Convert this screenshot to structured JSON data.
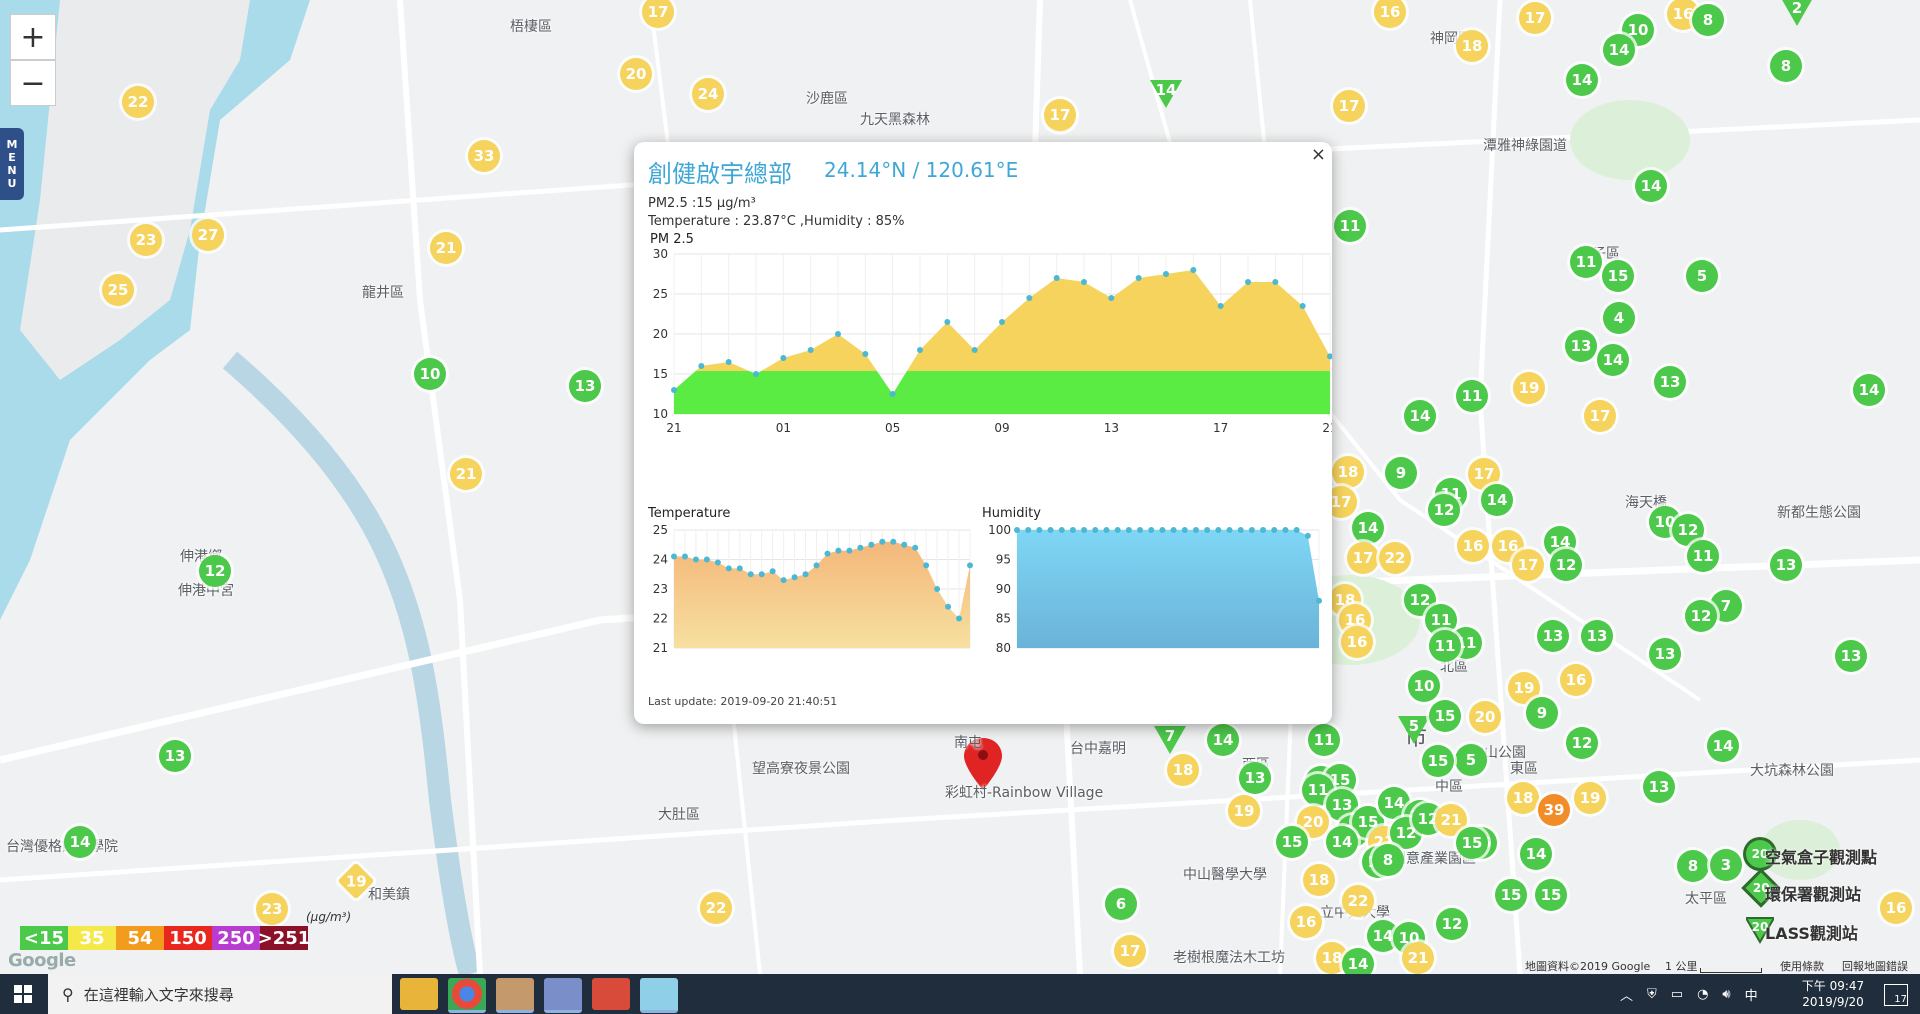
{
  "map": {
    "zoom_in": "+",
    "zoom_out": "−",
    "menu_letters": [
      "M",
      "E",
      "N",
      "U"
    ],
    "places": [
      {
        "id": "wuqi",
        "name": "梧棲區"
      },
      {
        "id": "shalu",
        "name": "沙鹿區"
      },
      {
        "id": "jiutianheisenlin",
        "name": "九天黑森林"
      },
      {
        "id": "longjing",
        "name": "龍井區"
      },
      {
        "id": "shengang",
        "name": "神岡區"
      },
      {
        "id": "tanya",
        "name": "潭雅神綠園道"
      },
      {
        "id": "tanzi",
        "name": "潭子區"
      },
      {
        "id": "xinshe",
        "name": "新都生態公園"
      },
      {
        "id": "haitiangiao",
        "name": "海天橋"
      },
      {
        "id": "shengang2",
        "name": "伸港鄉"
      },
      {
        "id": "shengang3",
        "name": "伸港中宮"
      },
      {
        "id": "wanggao",
        "name": "望高寮夜景公園"
      },
      {
        "id": "dadu",
        "name": "大肚區"
      },
      {
        "id": "caihong",
        "name": "彩虹村-Rainbow Village"
      },
      {
        "id": "nan",
        "name": "南屯"
      },
      {
        "id": "taichung_park",
        "name": "台中嘉明"
      },
      {
        "id": "xi",
        "name": "西區"
      },
      {
        "id": "bei",
        "name": "北區"
      },
      {
        "id": "city",
        "name": "市"
      },
      {
        "id": "zhong",
        "name": "中區"
      },
      {
        "id": "dong",
        "name": "東區"
      },
      {
        "id": "zhongshan",
        "name": "中山醫學大學"
      },
      {
        "id": "taiping",
        "name": "太平區"
      },
      {
        "id": "ldong",
        "name": "老樹根魔法木工坊"
      },
      {
        "id": "taiwan_stone",
        "name": "台灣優格餅乾學院"
      },
      {
        "id": "he_mei",
        "name": "和美鎮"
      },
      {
        "id": "daya",
        "name": "大坑森林公園"
      },
      {
        "id": "center",
        "name": "文化創意產業園區"
      },
      {
        "id": "zhongxing",
        "name": "立中興大學"
      },
      {
        "id": "fengyuan",
        "name": "豐原"
      },
      {
        "id": "park2",
        "name": "中山公園"
      }
    ],
    "markers": [
      {
        "v": "17",
        "c": "y"
      },
      {
        "v": "16",
        "c": "y"
      },
      {
        "v": "18",
        "c": "y"
      },
      {
        "v": "17",
        "c": "y"
      },
      {
        "v": "10",
        "c": "g"
      },
      {
        "v": "16",
        "c": "y"
      },
      {
        "v": "8",
        "c": "g"
      },
      {
        "v": "2",
        "c": "g",
        "t": "tri"
      },
      {
        "v": "22",
        "c": "y"
      },
      {
        "v": "20",
        "c": "y"
      },
      {
        "v": "24",
        "c": "y"
      },
      {
        "v": "17",
        "c": "y"
      },
      {
        "v": "14",
        "c": "g"
      },
      {
        "v": "17",
        "c": "y"
      },
      {
        "v": "14",
        "c": "g",
        "t": "tri"
      },
      {
        "v": "14",
        "c": "g"
      },
      {
        "v": "8",
        "c": "g"
      },
      {
        "v": "33",
        "c": "y"
      },
      {
        "v": "23",
        "c": "y"
      },
      {
        "v": "27",
        "c": "y"
      },
      {
        "v": "25",
        "c": "y"
      },
      {
        "v": "21",
        "c": "y"
      },
      {
        "v": "17",
        "c": "y"
      },
      {
        "v": "14",
        "c": "g"
      },
      {
        "v": "11",
        "c": "g"
      },
      {
        "v": "11",
        "c": "g"
      },
      {
        "v": "15",
        "c": "g"
      },
      {
        "v": "5",
        "c": "g"
      },
      {
        "v": "4",
        "c": "g"
      },
      {
        "v": "10",
        "c": "g"
      },
      {
        "v": "13",
        "c": "g"
      },
      {
        "v": "13",
        "c": "g"
      },
      {
        "v": "14",
        "c": "g"
      },
      {
        "v": "13",
        "c": "g"
      },
      {
        "v": "14",
        "c": "g"
      },
      {
        "v": "11",
        "c": "g"
      },
      {
        "v": "19",
        "c": "y"
      },
      {
        "v": "17",
        "c": "y"
      },
      {
        "v": "14",
        "c": "g"
      },
      {
        "v": "21",
        "c": "y"
      },
      {
        "v": "18",
        "c": "y"
      },
      {
        "v": "17",
        "c": "y"
      },
      {
        "v": "9",
        "c": "g"
      },
      {
        "v": "17",
        "c": "y"
      },
      {
        "v": "11",
        "c": "g"
      },
      {
        "v": "14",
        "c": "g"
      },
      {
        "v": "12",
        "c": "g"
      },
      {
        "v": "12",
        "c": "g"
      },
      {
        "v": "14",
        "c": "g"
      },
      {
        "v": "17",
        "c": "y"
      },
      {
        "v": "22",
        "c": "y"
      },
      {
        "v": "16",
        "c": "y"
      },
      {
        "v": "16",
        "c": "y"
      },
      {
        "v": "17",
        "c": "y"
      },
      {
        "v": "14",
        "c": "g"
      },
      {
        "v": "12",
        "c": "g"
      },
      {
        "v": "10",
        "c": "g"
      },
      {
        "v": "12",
        "c": "g"
      },
      {
        "v": "11",
        "c": "g"
      },
      {
        "v": "13",
        "c": "g"
      },
      {
        "v": "18",
        "c": "y"
      },
      {
        "v": "16",
        "c": "y"
      },
      {
        "v": "16",
        "c": "y"
      },
      {
        "v": "12",
        "c": "g"
      },
      {
        "v": "11",
        "c": "g"
      },
      {
        "v": "11",
        "c": "g"
      },
      {
        "v": "11",
        "c": "g"
      },
      {
        "v": "13",
        "c": "g"
      },
      {
        "v": "13",
        "c": "g"
      },
      {
        "v": "7",
        "c": "g"
      },
      {
        "v": "13",
        "c": "g"
      },
      {
        "v": "12",
        "c": "g"
      },
      {
        "v": "13",
        "c": "g"
      },
      {
        "v": "13",
        "c": "g"
      },
      {
        "v": "5",
        "c": "g",
        "t": "tri"
      },
      {
        "v": "10",
        "c": "g"
      },
      {
        "v": "15",
        "c": "g"
      },
      {
        "v": "20",
        "c": "y"
      },
      {
        "v": "19",
        "c": "y"
      },
      {
        "v": "9",
        "c": "g"
      },
      {
        "v": "16",
        "c": "y"
      },
      {
        "v": "12",
        "c": "g"
      },
      {
        "v": "14",
        "c": "g"
      },
      {
        "v": "5",
        "c": "g"
      },
      {
        "v": "11",
        "c": "g"
      },
      {
        "v": "7",
        "c": "g",
        "t": "tri"
      },
      {
        "v": "18",
        "c": "y"
      },
      {
        "v": "14",
        "c": "g"
      },
      {
        "v": "13",
        "c": "g"
      },
      {
        "v": "12",
        "c": "g"
      },
      {
        "v": "15",
        "c": "g"
      },
      {
        "v": "15",
        "c": "g"
      },
      {
        "v": "11",
        "c": "g"
      },
      {
        "v": "18",
        "c": "y"
      },
      {
        "v": "39",
        "c": "o"
      },
      {
        "v": "19",
        "c": "y"
      },
      {
        "v": "13",
        "c": "g"
      },
      {
        "v": "13",
        "c": "g"
      },
      {
        "v": "15",
        "c": "g"
      },
      {
        "v": "15",
        "c": "g"
      },
      {
        "v": "19",
        "c": "y"
      },
      {
        "v": "20",
        "c": "y"
      },
      {
        "v": "15",
        "c": "g"
      },
      {
        "v": "14",
        "c": "g"
      },
      {
        "v": "14",
        "c": "g"
      },
      {
        "v": "15",
        "c": "g"
      },
      {
        "v": "21",
        "c": "y"
      },
      {
        "v": "12",
        "c": "g"
      },
      {
        "v": "10",
        "c": "g"
      },
      {
        "v": "12",
        "c": "g"
      },
      {
        "v": "21",
        "c": "y"
      },
      {
        "v": "15",
        "c": "g"
      },
      {
        "v": "14",
        "c": "g"
      },
      {
        "v": "15",
        "c": "g"
      },
      {
        "v": "8",
        "c": "g"
      },
      {
        "v": "8",
        "c": "g"
      },
      {
        "v": "3",
        "c": "g"
      },
      {
        "v": "14",
        "c": "g"
      },
      {
        "v": "19",
        "c": "y",
        "t": "dia"
      },
      {
        "v": "23",
        "c": "y"
      },
      {
        "v": "22",
        "c": "y"
      },
      {
        "v": "6",
        "c": "g"
      },
      {
        "v": "17",
        "c": "y"
      },
      {
        "v": "18",
        "c": "y"
      },
      {
        "v": "16",
        "c": "y"
      },
      {
        "v": "22",
        "c": "y"
      },
      {
        "v": "14",
        "c": "g"
      },
      {
        "v": "10",
        "c": "g"
      },
      {
        "v": "12",
        "c": "g"
      },
      {
        "v": "15",
        "c": "g"
      },
      {
        "v": "15",
        "c": "g"
      },
      {
        "v": "16",
        "c": "y"
      },
      {
        "v": "21",
        "c": "y"
      },
      {
        "v": "18",
        "c": "y"
      },
      {
        "v": "14",
        "c": "g"
      },
      {
        "v": "16",
        "c": "y"
      }
    ],
    "colors": {
      "g": "#4cc84a",
      "y": "#f5d35c",
      "o": "#f28c28",
      "r": "#e8281e",
      "water": "#a9dbea",
      "land": "#f0f1f2",
      "road": "#ffffff",
      "river": "#b8d6e3"
    }
  },
  "popup": {
    "close": "×",
    "site_name": "創健啟宇總部",
    "coords": "24.14°N / 120.61°E",
    "pm25_line": "PM2.5 :15 μg/m³",
    "temp_humidity_line": "Temperature : 23.87°C ,Humidity : 85%",
    "last_update": "Last update: 2019-09-20 21:40:51"
  },
  "chart_data": [
    {
      "type": "area",
      "title": "PM 2.5",
      "x": [
        "21",
        "22",
        "23",
        "00",
        "01",
        "02",
        "03",
        "04",
        "05",
        "06",
        "07",
        "08",
        "09",
        "10",
        "11",
        "12",
        "13",
        "14",
        "15",
        "16",
        "17",
        "18",
        "19",
        "20",
        "21"
      ],
      "xticks": [
        "21",
        "01",
        "05",
        "09",
        "13",
        "17",
        "21"
      ],
      "values": [
        13,
        16,
        16.5,
        15,
        17,
        18,
        20,
        17.5,
        12.5,
        18,
        21.5,
        18,
        21.5,
        24.5,
        27,
        26.5,
        24.5,
        27,
        27.5,
        28,
        23.5,
        26.5,
        26.5,
        23.5,
        17.2
      ],
      "ylim": [
        10,
        30
      ],
      "yticks": [
        10,
        15,
        20,
        25,
        30
      ],
      "threshold": 15.4,
      "colors": {
        "above": "#f5d35c",
        "below": "#5aec43",
        "point": "#4bb8d4"
      }
    },
    {
      "type": "area",
      "title": "Temperature",
      "values": [
        24.1,
        24.1,
        24.0,
        24.0,
        23.9,
        23.7,
        23.7,
        23.5,
        23.5,
        23.6,
        23.3,
        23.4,
        23.5,
        23.8,
        24.2,
        24.3,
        24.3,
        24.4,
        24.5,
        24.6,
        24.6,
        24.5,
        24.4,
        23.8,
        23.0,
        22.4,
        22.0,
        23.8
      ],
      "ylim": [
        21,
        25
      ],
      "yticks": [
        21,
        22,
        23,
        24,
        25
      ],
      "colors": {
        "top": "#f4b77a",
        "bottom": "#f7e0a0",
        "point": "#4bb8d4"
      }
    },
    {
      "type": "area",
      "title": "Humidity",
      "values": [
        100,
        100,
        100,
        100,
        100,
        100,
        100,
        100,
        100,
        100,
        100,
        100,
        100,
        100,
        100,
        100,
        100,
        100,
        100,
        100,
        100,
        100,
        100,
        100,
        100,
        100,
        99,
        88
      ],
      "ylim": [
        80,
        100
      ],
      "yticks": [
        80,
        85,
        90,
        95,
        100
      ],
      "colors": {
        "top": "#7fd6f5",
        "bottom": "#6ab3d8",
        "point": "#4bb8d4"
      }
    }
  ],
  "legend": {
    "unit": "(μg/m³)",
    "items": [
      {
        "label": "<15",
        "color": "#4cc84a"
      },
      {
        "label": "35",
        "color": "#f5e94a"
      },
      {
        "label": "54",
        "color": "#f29b1d"
      },
      {
        "label": "150",
        "color": "#e8281e"
      },
      {
        "label": "250",
        "color": "#b83ccf"
      },
      {
        "label": ">251",
        "color": "#8b1028"
      }
    ]
  },
  "station_legend": [
    {
      "label": "空氣盒子觀測點",
      "value": "20"
    },
    {
      "label": "環保署觀測站",
      "value": "20"
    },
    {
      "label": "LASS觀測站",
      "value": "20"
    }
  ],
  "google_logo": "Google",
  "credits": {
    "data": "地圖資料©2019 Google",
    "scale": "1 公里",
    "terms": "使用條款",
    "report": "回報地圖錯誤"
  },
  "taskbar": {
    "search_placeholder": "在這裡輸入文字來搜尋",
    "time": "下午 09:47",
    "date": "2019/9/20",
    "ime": "中",
    "notifications": "17"
  }
}
